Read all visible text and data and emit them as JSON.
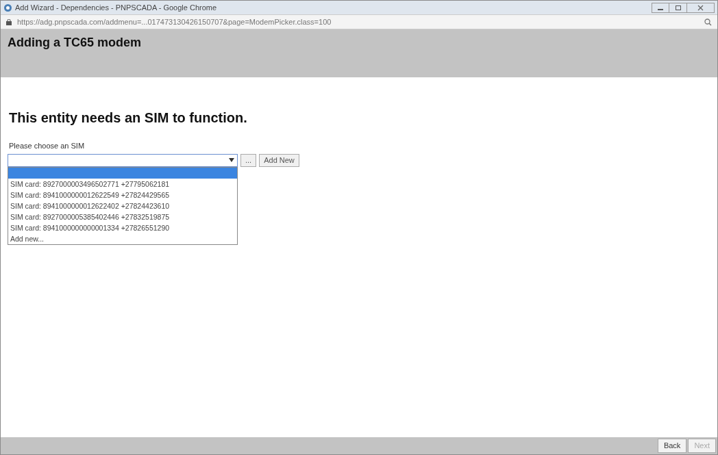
{
  "window": {
    "title": "Add Wizard - Dependencies - PNPSCADA - Google Chrome"
  },
  "address_bar": {
    "url": "https://adg.pnpscada.com/addmenu=...017473130426150707&page=ModemPicker.class=100"
  },
  "header": {
    "title": "Adding a TC65 modem"
  },
  "heading": "This entity needs an SIM to function.",
  "field": {
    "label": "Please choose an SIM"
  },
  "dropdown": {
    "expanded": true,
    "options": [
      {
        "selected": true
      },
      {
        "label": "SIM card: 8927000003496502771 +27795062181",
        "selected": false
      },
      {
        "label": "SIM card: 8941000000012622549 +27824429565",
        "selected": false
      },
      {
        "label": "SIM card: 8941000000012622402 +27824423610",
        "selected": false
      },
      {
        "label": "SIM card: 8927000005385402446 +27832519875",
        "selected": false
      },
      {
        "label": "SIM card: 8941000000000001334 +27826551290",
        "selected": false
      },
      {
        "label": "Add new...",
        "selected": false
      }
    ]
  },
  "side_buttons": [
    "...",
    "Add New"
  ],
  "footer": {
    "buttons": [
      {
        "label": "Back",
        "disabled": false
      },
      {
        "label": "Next",
        "disabled": true
      }
    ]
  }
}
